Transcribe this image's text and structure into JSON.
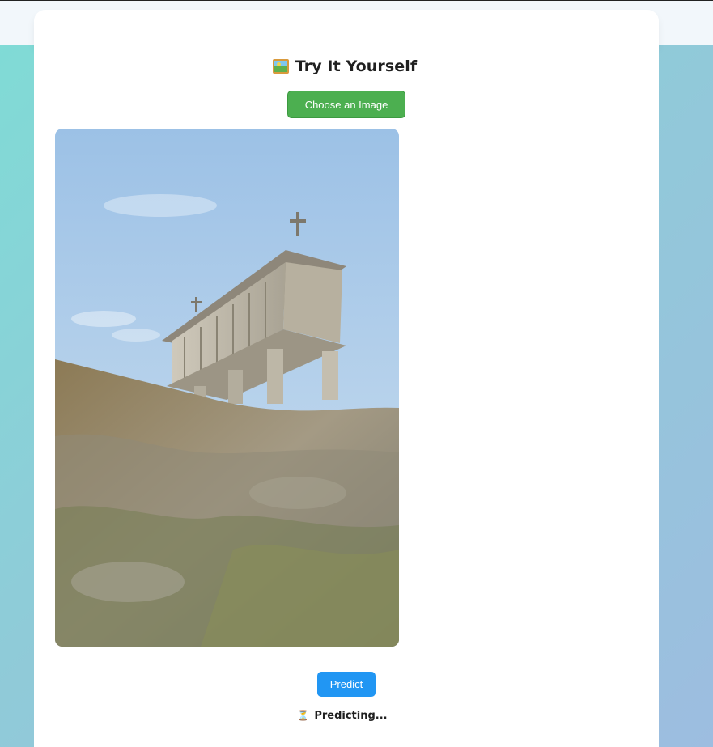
{
  "section": {
    "title": "Try It Yourself",
    "title_icon": "framed-picture-icon"
  },
  "upload": {
    "choose_label": "Choose an Image"
  },
  "preview": {
    "image_description": "stone granary on rock"
  },
  "actions": {
    "predict_label": "Predict"
  },
  "status": {
    "icon": "hourglass-icon",
    "text": "Predicting..."
  },
  "colors": {
    "choose_button": "#4caf50",
    "predict_button": "#2196f3",
    "background_start": "#7fdcd6",
    "background_end": "#9dbde0"
  }
}
